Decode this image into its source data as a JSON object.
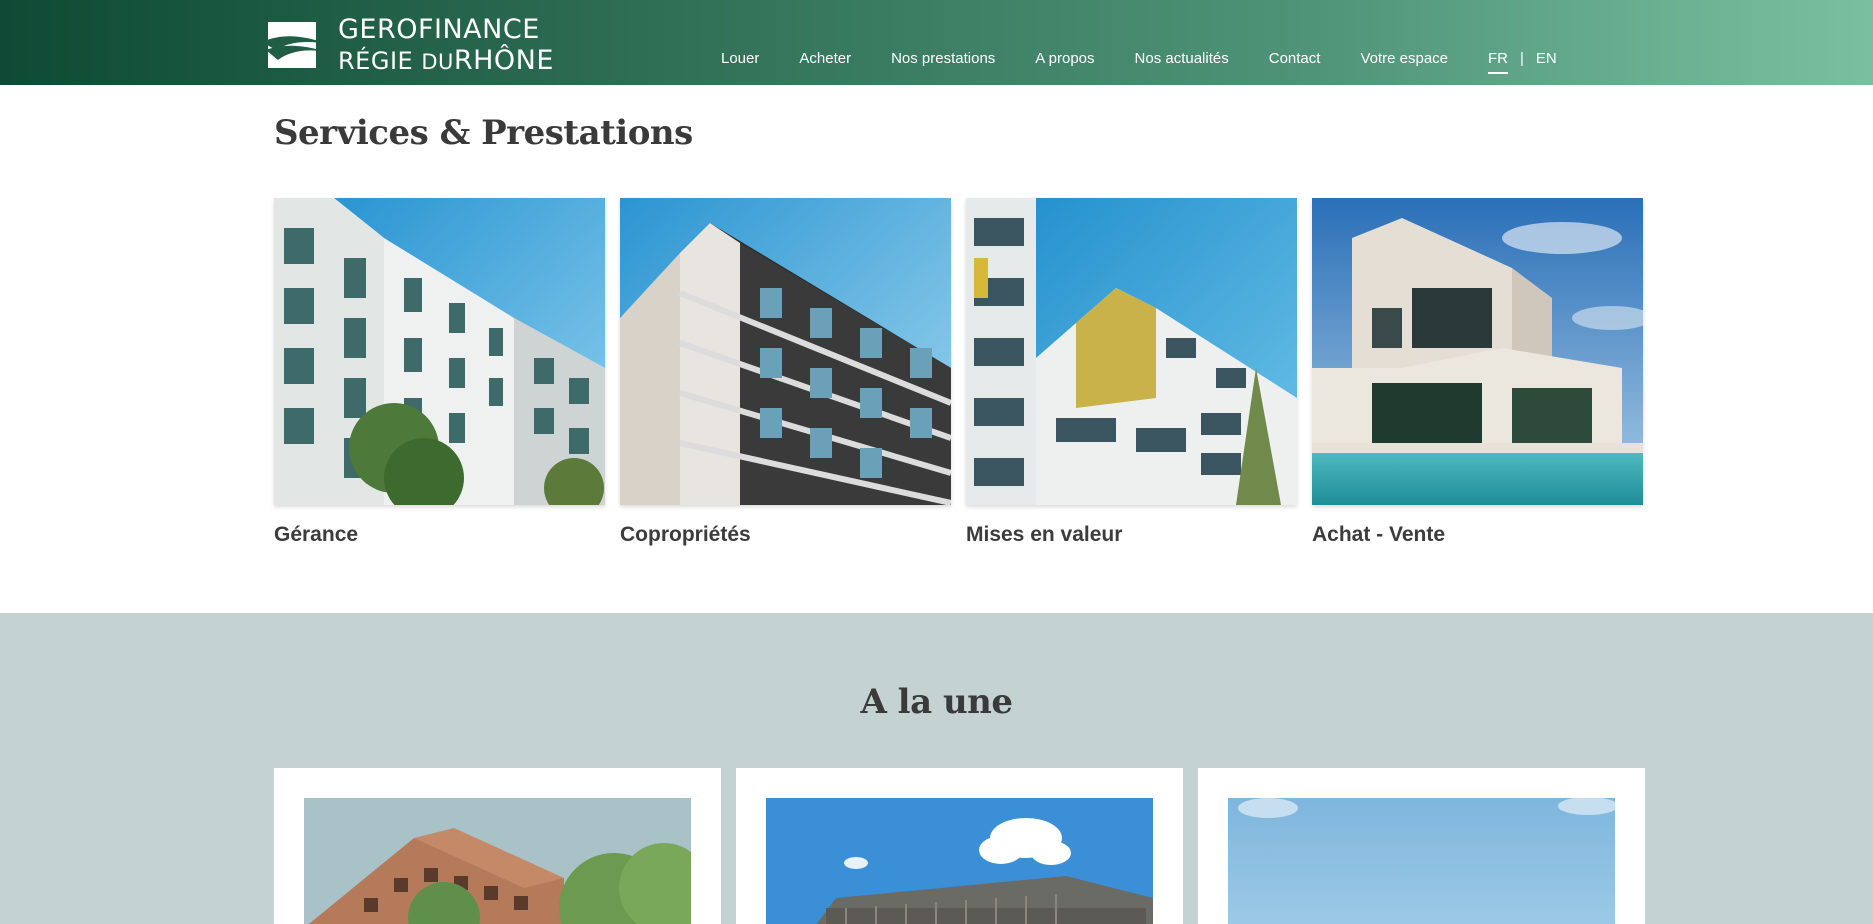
{
  "header": {
    "logo": {
      "line1": "GEROFINANCE",
      "line2_prefix": "RÉGIE ",
      "line2_du": "DU",
      "line2_suffix": "RHÔNE"
    },
    "nav": [
      "Louer",
      "Acheter",
      "Nos prestations",
      "A propos",
      "Nos actualités",
      "Contact",
      "Votre espace"
    ],
    "languages": {
      "active": "FR",
      "separator": "|",
      "other": "EN"
    }
  },
  "services": {
    "title": "Services & Prestations",
    "cards": [
      {
        "label": "Gérance",
        "icon": "white-apartment-building-photo"
      },
      {
        "label": "Copropriétés",
        "icon": "modern-residential-building-photo"
      },
      {
        "label": "Mises en valeur",
        "icon": "yellow-accent-building-photo"
      },
      {
        "label": "Achat - Vente",
        "icon": "villa-with-pool-photo"
      }
    ]
  },
  "une": {
    "title": "A la une",
    "cards": [
      {
        "icon": "brick-residential-project-photo"
      },
      {
        "icon": "wooden-facade-project-photo"
      },
      {
        "icon": "sky-landscape-photo"
      }
    ]
  },
  "colors": {
    "header_dark": "#0e4a35",
    "header_light": "#7ac0a0",
    "une_background": "#c4d2d2",
    "heading_text": "#3a3a3a"
  }
}
